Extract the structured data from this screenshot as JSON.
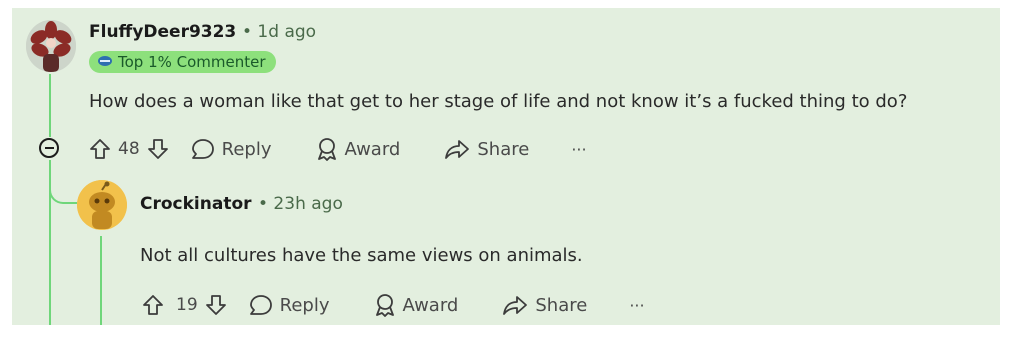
{
  "comment": {
    "username": "FluffyDeer9323",
    "time": "• 1d ago",
    "badge": "Top 1% Commenter",
    "body": "How does a woman like that get to her stage of life and not know it’s a fucked thing to do?",
    "votes": "48",
    "reply_label": "Reply",
    "award_label": "Award",
    "share_label": "Share",
    "more_label": "···"
  },
  "reply": {
    "username": "Crockinator",
    "time": "• 23h ago",
    "body": "Not all cultures have the same views on animals.",
    "votes": "19",
    "reply_label": "Reply",
    "award_label": "Award",
    "share_label": "Share",
    "more_label": "···"
  },
  "colors": {
    "background": "#e3efdf",
    "thread_line": "#6fd67a",
    "badge": "#8de07c",
    "reply_avatar": "#f2c14b"
  }
}
